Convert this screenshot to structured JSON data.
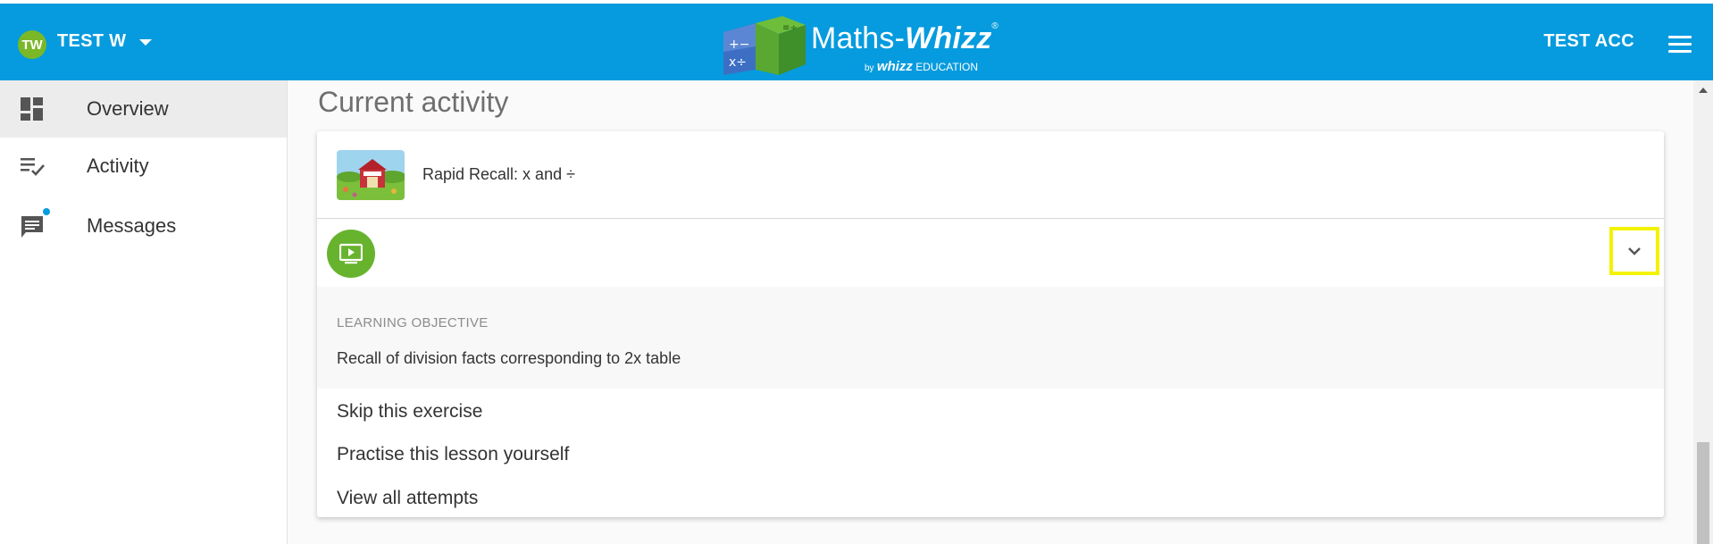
{
  "header": {
    "user_initials": "TW",
    "user_name": "TEST W",
    "logo_main": "Maths-",
    "logo_brand": "Whizz",
    "logo_reg": "®",
    "logo_by": "by",
    "logo_whizz": "whizz",
    "logo_education": "EDUCATION",
    "account_label": "TEST ACC"
  },
  "sidebar": {
    "items": [
      {
        "label": "Overview",
        "icon": "dashboard-icon",
        "active": true
      },
      {
        "label": "Activity",
        "icon": "checklist-icon",
        "active": false
      },
      {
        "label": "Messages",
        "icon": "message-icon",
        "active": false,
        "badge": true
      }
    ]
  },
  "main": {
    "section_title": "Current activity",
    "card": {
      "activity_name": "Rapid Recall: x and ÷",
      "objective_label": "LEARNING OBJECTIVE",
      "objective_text": "Recall of division facts corresponding to 2x table",
      "actions": [
        "Skip this exercise",
        "Practise this lesson yourself",
        "View all attempts"
      ]
    }
  },
  "colors": {
    "header_bg": "#069bde",
    "avatar_bg": "#7ab828",
    "play_bg": "#67b32e",
    "highlight": "#f3f300"
  }
}
